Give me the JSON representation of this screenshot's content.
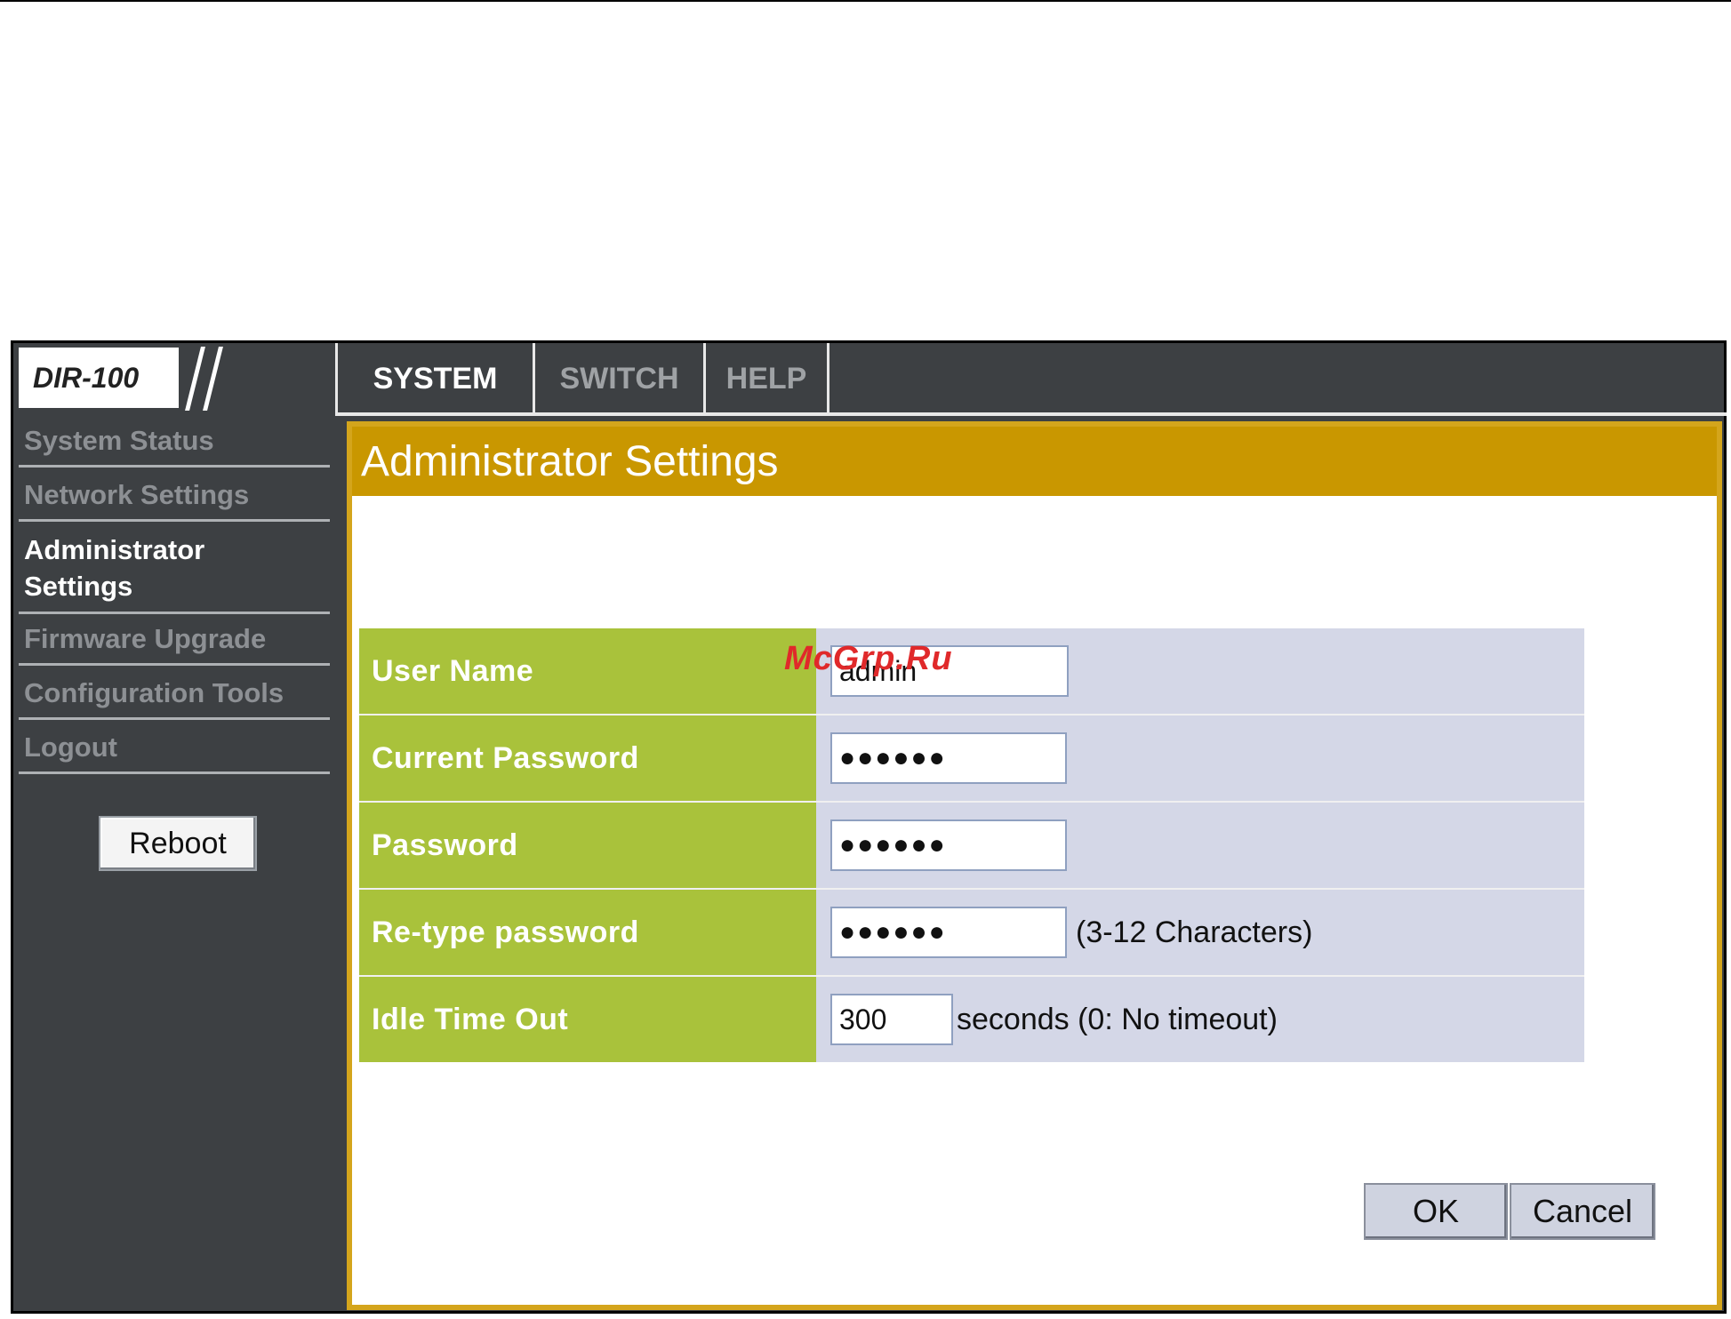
{
  "header": {
    "logo": "DIR-100",
    "tabs": [
      {
        "label": "SYSTEM",
        "active": true
      },
      {
        "label": "SWITCH",
        "active": false
      },
      {
        "label": "HELP",
        "active": false
      }
    ]
  },
  "sidebar": {
    "items": [
      {
        "label": "System Status",
        "active": false
      },
      {
        "label": "Network Settings",
        "active": false
      },
      {
        "label": "Administrator Settings",
        "active": true
      },
      {
        "label": "Firmware Upgrade",
        "active": false
      },
      {
        "label": "Configuration Tools",
        "active": false
      },
      {
        "label": "Logout",
        "active": false
      }
    ],
    "reboot_label": "Reboot"
  },
  "content": {
    "title": "Administrator Settings",
    "fields": {
      "username": {
        "label": "User Name",
        "value": "admin"
      },
      "current_password": {
        "label": "Current Password",
        "value": "●●●●●●"
      },
      "password": {
        "label": "Password",
        "value": "●●●●●●"
      },
      "retype_password": {
        "label": "Re-type password",
        "value": "●●●●●●",
        "hint": "(3-12 Characters)"
      },
      "idle_timeout": {
        "label": "Idle Time Out",
        "value": "300",
        "hint": "seconds (0: No timeout)"
      }
    },
    "ok_label": "OK",
    "cancel_label": "Cancel"
  },
  "watermark": "McGrp.Ru",
  "colors": {
    "header_bg": "#3d4043",
    "title_bar": "#c99700",
    "panel_border": "#d4a51c",
    "label_bg": "#a9c23b",
    "field_bg": "#d4d7e7"
  }
}
